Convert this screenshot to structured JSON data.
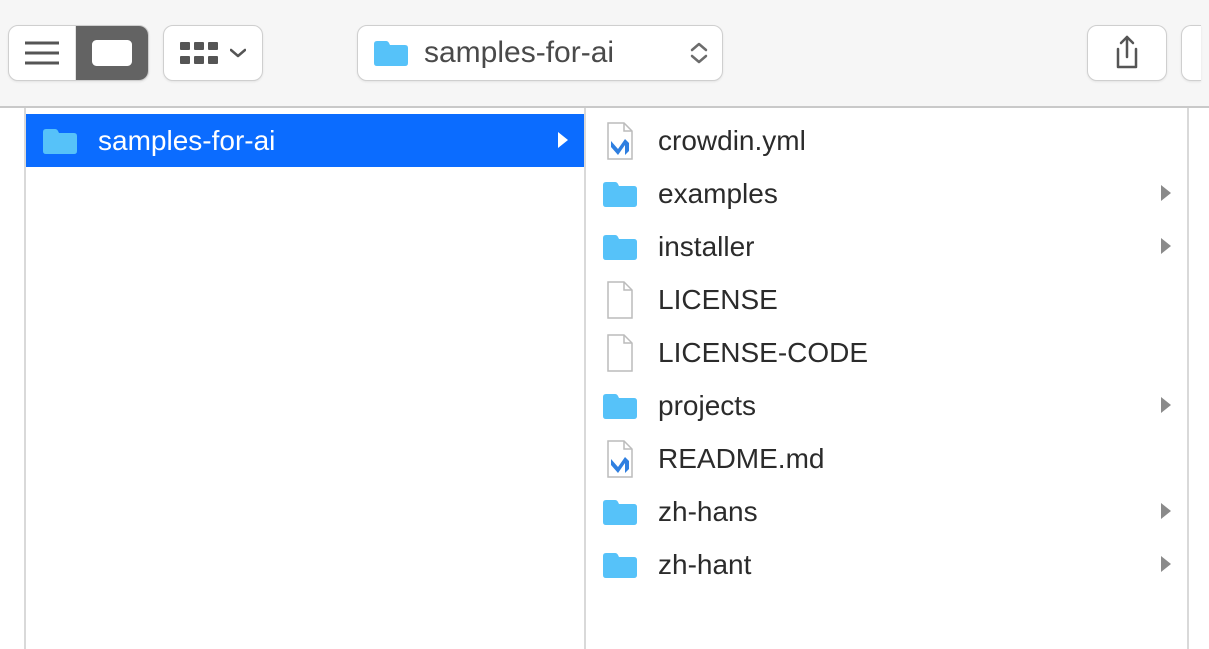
{
  "path_bar": {
    "current_folder": "samples-for-ai"
  },
  "column1": {
    "items": [
      {
        "name": "samples-for-ai",
        "type": "folder",
        "selected": true,
        "has_children": true
      }
    ]
  },
  "column2": {
    "items": [
      {
        "name": "crowdin.yml",
        "type": "vsfile",
        "has_children": false
      },
      {
        "name": "examples",
        "type": "folder",
        "has_children": true
      },
      {
        "name": "installer",
        "type": "folder",
        "has_children": true
      },
      {
        "name": "LICENSE",
        "type": "file",
        "has_children": false
      },
      {
        "name": "LICENSE-CODE",
        "type": "file",
        "has_children": false
      },
      {
        "name": "projects",
        "type": "folder",
        "has_children": true
      },
      {
        "name": "README.md",
        "type": "vsfile",
        "has_children": false
      },
      {
        "name": "zh-hans",
        "type": "folder",
        "has_children": true
      },
      {
        "name": "zh-hant",
        "type": "folder",
        "has_children": true
      }
    ]
  }
}
